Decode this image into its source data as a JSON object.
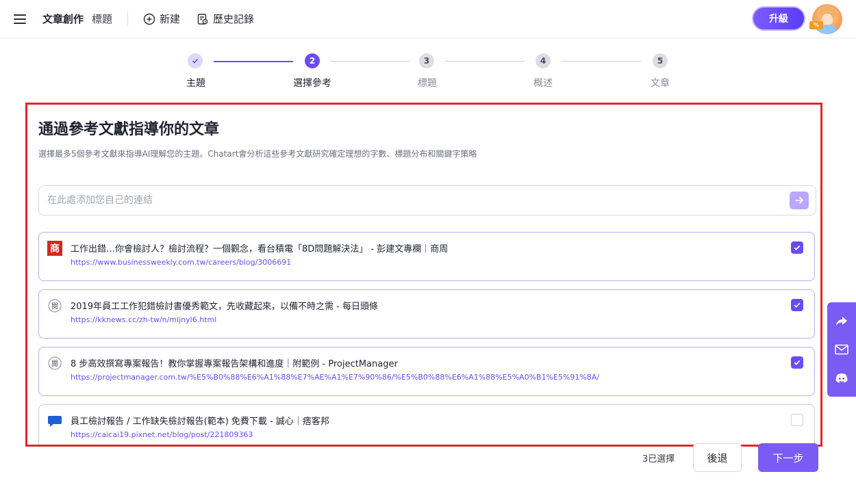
{
  "header": {
    "app_title": "文章創作",
    "breadcrumb": "標題",
    "new_label": "新建",
    "history_label": "歷史記錄",
    "upgrade_label": "升級",
    "avatar_badge": "%"
  },
  "stepper": {
    "steps": [
      {
        "number": "✓",
        "label": "主題",
        "state": "done"
      },
      {
        "number": "2",
        "label": "選擇參考",
        "state": "active"
      },
      {
        "number": "3",
        "label": "標題",
        "state": "todo"
      },
      {
        "number": "4",
        "label": "概述",
        "state": "todo"
      },
      {
        "number": "5",
        "label": "文章",
        "state": "todo"
      }
    ]
  },
  "main": {
    "heading": "通過參考文獻指導你的文章",
    "description": "選擇最多5個參考文獻來指導AI理解您的主題。Chatart會分析這些參考文獻研究確定理想的字數、標題分布和關鍵字策略",
    "link_placeholder": "在此處添加您自己的連結",
    "references": [
      {
        "title": "工作出錯…你會檢討人？檢討流程？一個觀念，看台積電「8D問題解決法」 - 彭建文專欄｜商周",
        "url": "https://www.businessweekly.com.tw/careers/blog/3006691",
        "icon": "businessweekly-logo-icon",
        "icon_char": "商",
        "checked": true
      },
      {
        "title": "2019年員工工作犯錯檢討書優秀範文，先收藏起來，以備不時之需 - 每日頭條",
        "url": "https://kknews.cc/zh-tw/n/mljnyl6.html",
        "icon": "kknews-logo-icon",
        "icon_char": "閱",
        "checked": true
      },
      {
        "title": "8 步高效撰寫專案報告！教你掌握專案報告架構和進度｜附範例 - ProjectManager",
        "url": "https://projectmanager.com.tw/%E5%B0%88%E6%A1%88%E7%AE%A1%E7%90%86/%E5%B0%88%E6%A1%88%E5%A0%B1%E5%91%8A/",
        "icon": "projectmanager-logo-icon",
        "icon_char": "閱",
        "checked": true
      },
      {
        "title": "員工檢討報告 / 工作缺失檢討報告(範本) 免費下載 - 誠心｜痞客邦",
        "url": "https://caicai19.pixnet.net/blog/post/221809363",
        "icon": "pixnet-logo-icon",
        "icon_char": "",
        "checked": false
      }
    ]
  },
  "footer": {
    "selected_count": "3已選擇",
    "back_label": "後退",
    "next_label": "下一步"
  },
  "colors": {
    "accent": "#6a4cf0",
    "highlight_border": "#e0262c"
  }
}
